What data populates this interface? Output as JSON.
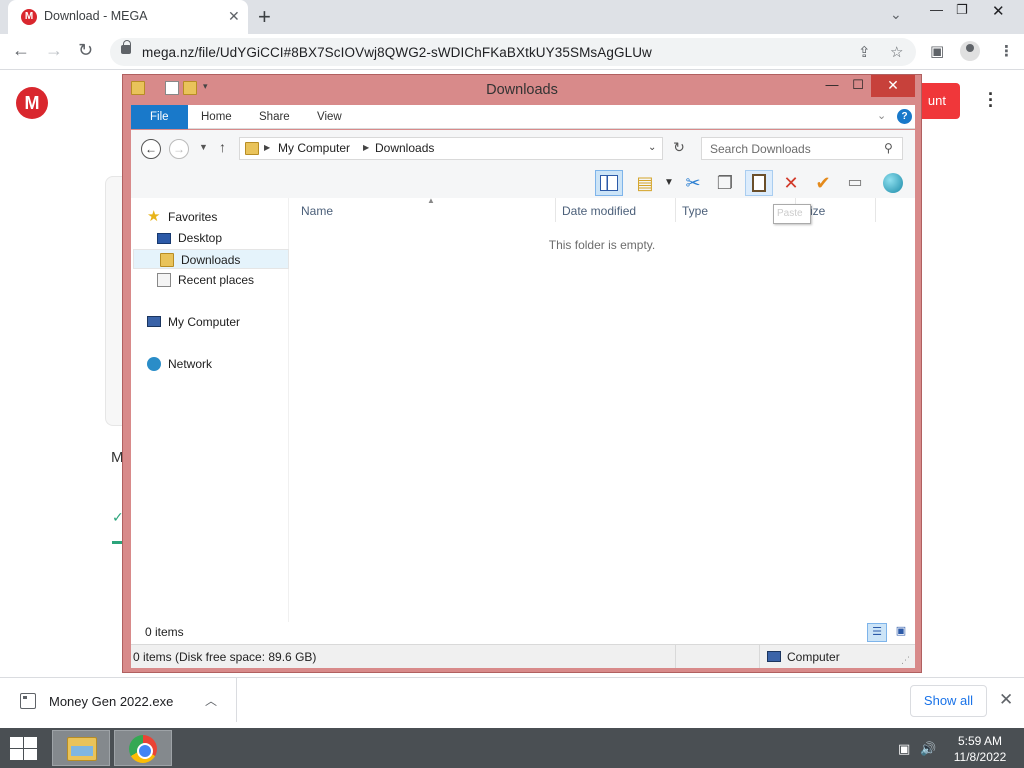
{
  "browser": {
    "tab": {
      "title": "Download - MEGA",
      "favicon": "M"
    },
    "url": "mega.nz/file/UdYGiCCI#8BX7ScIOVwj8QWG2-sWDIChFKaBXtkUY35SMsAgGLUw"
  },
  "mega_page": {
    "logo": "M",
    "account_button_fragment": "unt",
    "card_letter": "M"
  },
  "explorer": {
    "title": "Downloads",
    "ribbon_tabs": [
      "File",
      "Home",
      "Share",
      "View"
    ],
    "address": {
      "crumb1": "My Computer",
      "crumb2": "Downloads"
    },
    "search_placeholder": "Search Downloads",
    "navpane": {
      "favorites": "Favorites",
      "desktop": "Desktop",
      "downloads": "Downloads",
      "recent": "Recent places",
      "computer": "My Computer",
      "network": "Network"
    },
    "columns": {
      "name": "Name",
      "date": "Date modified",
      "type": "Type",
      "size": "Size"
    },
    "empty_message": "This folder is empty.",
    "tooltip": "Paste",
    "item_count": "0 items",
    "status": {
      "left": "0 items (Disk free space: 89.6 GB)",
      "right": "Computer"
    }
  },
  "download_shelf": {
    "file_name": "Money Gen 2022.exe",
    "show_all": "Show all"
  },
  "taskbar": {
    "time": "5:59 AM",
    "date": "11/8/2022"
  }
}
